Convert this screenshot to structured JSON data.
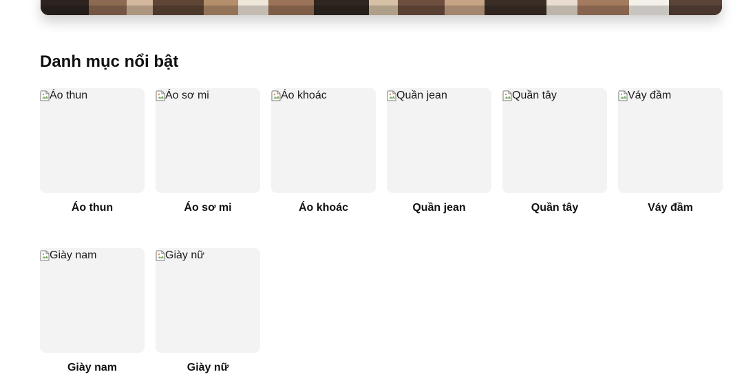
{
  "banner": {
    "image_alt": "",
    "tones": [
      "#3a2a22",
      "#7d5d47",
      "#c1a387",
      "#e9dccb",
      "#9a7058",
      "#f3eee7",
      "#5b4539",
      "#d7b79b",
      "#2d241f",
      "#b8977d"
    ]
  },
  "section": {
    "title": "Danh mục nổi bật"
  },
  "categories": [
    {
      "image_alt": "Áo thun",
      "label": "Áo thun"
    },
    {
      "image_alt": "Áo sơ mi",
      "label": "Áo sơ mi"
    },
    {
      "image_alt": "Áo khoác",
      "label": "Áo khoác"
    },
    {
      "image_alt": "Quần jean",
      "label": "Quần jean"
    },
    {
      "image_alt": "Quần tây",
      "label": "Quần tây"
    },
    {
      "image_alt": "Váy đầm",
      "label": "Váy đầm"
    },
    {
      "image_alt": "Giày nam",
      "label": "Giày nam"
    },
    {
      "image_alt": "Giày nữ",
      "label": "Giày nữ"
    }
  ],
  "colors": {
    "placeholder_bg": "#f3f3f3",
    "text": "#111111"
  },
  "icons": {
    "broken_image": "broken-image-icon"
  }
}
